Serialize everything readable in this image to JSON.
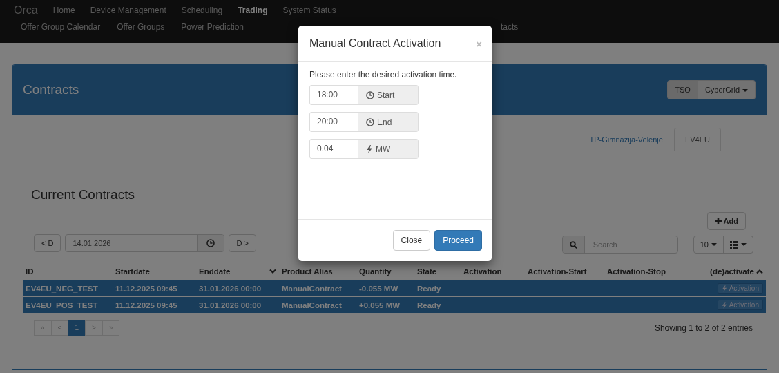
{
  "navbar": {
    "brand": "Orca",
    "primary_items": [
      {
        "label": "Home",
        "selected": false
      },
      {
        "label": "Device Management",
        "selected": false
      },
      {
        "label": "Scheduling",
        "selected": false
      },
      {
        "label": "Trading",
        "selected": true
      },
      {
        "label": "System Status",
        "selected": false
      }
    ],
    "secondary_items": [
      {
        "label": "Offer Group Calendar"
      },
      {
        "label": "Offer Groups"
      },
      {
        "label": "Power Prediction"
      },
      {
        "label": "tacts"
      }
    ]
  },
  "panel": {
    "title": "Contracts",
    "role_label": "TSO",
    "company_dropdown": "CyberGrid",
    "tabs": [
      {
        "label": "TP-Gimnazija-Velenje",
        "selected": false
      },
      {
        "label": "EV4EU",
        "selected": true
      }
    ],
    "section_title": "Current Contracts",
    "date_nav": {
      "prev": "< D",
      "date": "14.01.2026",
      "next": "D >"
    },
    "add_button": "Add",
    "search": {
      "placeholder": "Search"
    },
    "page_size": "10",
    "table": {
      "columns": [
        {
          "label": "ID",
          "kind": "plain"
        },
        {
          "label": "Startdate",
          "kind": "plain"
        },
        {
          "label": "Enddate",
          "kind": "sortdown"
        },
        {
          "label": "Product Alias",
          "kind": "plain"
        },
        {
          "label": "Quantity",
          "kind": "plain"
        },
        {
          "label": "State",
          "kind": "plain"
        },
        {
          "label": "Activation",
          "kind": "plain"
        },
        {
          "label": "Activation-Start",
          "kind": "plain"
        },
        {
          "label": "Activation-Stop",
          "kind": "plain"
        },
        {
          "label": "(de)activate",
          "kind": "sortup"
        }
      ],
      "rows": [
        {
          "id": "EV4EU_NEG_TEST",
          "startdate": "11.12.2025 09:45",
          "enddate": "31.01.2026 00:00",
          "product_alias": "ManualContract",
          "quantity": "-0.055 MW",
          "state": "Ready",
          "action": "Activation",
          "selected": true
        },
        {
          "id": "EV4EU_POS_TEST",
          "startdate": "11.12.2025 09:45",
          "enddate": "31.01.2026 00:00",
          "product_alias": "ManualContract",
          "quantity": "+0.055 MW",
          "state": "Ready",
          "action": "Activation",
          "selected": true
        }
      ]
    },
    "pagination": [
      {
        "label": "«",
        "selected": false,
        "disabled": true
      },
      {
        "label": "<",
        "selected": false,
        "disabled": true
      },
      {
        "label": "1",
        "selected": true,
        "disabled": false
      },
      {
        "label": ">",
        "selected": false,
        "disabled": true
      },
      {
        "label": "»",
        "selected": false,
        "disabled": true
      }
    ],
    "summary": "Showing 1 to 2 of 2 entries"
  },
  "modal": {
    "title": "Manual Contract Activation",
    "close_symbol": "×",
    "prompt": "Please enter the desired activation time.",
    "fields": [
      {
        "value": "18:00",
        "addon": "Start",
        "kind": "time"
      },
      {
        "value": "20:00",
        "addon": "End",
        "kind": "time"
      },
      {
        "value": "0.04",
        "addon": "MW",
        "kind": "power"
      }
    ],
    "buttons": [
      {
        "label": "Close",
        "kind": "default"
      },
      {
        "label": "Proceed",
        "kind": "primary"
      }
    ]
  }
}
